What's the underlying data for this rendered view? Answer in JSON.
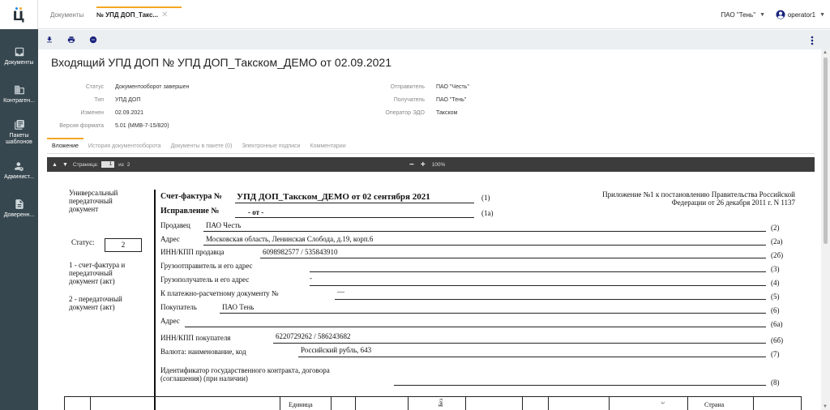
{
  "brand": {
    "letter": "Ц",
    "dot_colors": [
      "#1e88e5",
      "#f5a623"
    ]
  },
  "sidebar": {
    "items": [
      {
        "label": "Документы",
        "icon": "inbox-icon"
      },
      {
        "label": "Контраген...",
        "icon": "building-icon"
      },
      {
        "label": "Пакеты шаблонов",
        "icon": "layers-icon"
      },
      {
        "label": "Админист...",
        "icon": "admin-gear-icon"
      },
      {
        "label": "Доверенн...",
        "icon": "document-icon"
      }
    ]
  },
  "header": {
    "tabs": [
      {
        "label": "Документы",
        "active": false
      },
      {
        "label": "№ УПД ДОП_Такс...",
        "active": true
      }
    ],
    "close": "✕",
    "org": "ПАО \"Тень\"",
    "user": "operator1"
  },
  "toolbar": {
    "icons": [
      "download-icon",
      "print-icon",
      "minus-circle-icon"
    ],
    "more": "more-vert-icon"
  },
  "page": {
    "title": "Входящий УПД ДОП № УПД ДОП_Такском_ДЕМО от 02.09.2021",
    "meta_left": [
      {
        "k": "Статус",
        "v": "Документооборот завершен"
      },
      {
        "k": "Тип",
        "v": "УПД ДОП"
      },
      {
        "k": "Изменен",
        "v": "02.09.2021"
      },
      {
        "k": "Версия формата",
        "v": "5.01 (ММВ-7-15/820)"
      }
    ],
    "meta_right": [
      {
        "k": "Отправитель",
        "v": "ПАО \"Честь\""
      },
      {
        "k": "Получатель",
        "v": "ПАО \"Тень\""
      },
      {
        "k": "Оператор ЭДО",
        "v": "Такском"
      }
    ],
    "subtabs": [
      "Вложение",
      "История документооборота",
      "Документы в пакете (0)",
      "Электронные подписи",
      "Комментарии"
    ]
  },
  "viewer": {
    "page_label": "Страница:",
    "page": "1",
    "of": "из",
    "total": "2",
    "zoom": "100%",
    "minus": "−",
    "plus": "+"
  },
  "document": {
    "left_label": [
      "Универсальный",
      "передаточный",
      "документ"
    ],
    "status_label": "Статус:",
    "status_value": "2",
    "legend_1": [
      "1 - счет-фактура и",
      "передаточный",
      "документ (акт)"
    ],
    "legend_2": [
      "2 - передаточный",
      "документ (акт)"
    ],
    "invoice_label": "Счет-фактура №",
    "invoice_value": "УПД ДОП_Такском_ДЕМО от 02 сентября 2021",
    "correction_label": "Исправление №",
    "correction_value": "-      от      -",
    "appendix": [
      "Приложение №1 к постановлению Правительства Российской",
      "Федерации от 26 декабря 2011 г. N 1137"
    ],
    "rows": [
      {
        "k": "Продавец",
        "v": "ПАО Честь",
        "n": "(2)"
      },
      {
        "k": "Адрес",
        "v": "Московская область, Ленинская Слобода, д.19, корп.6",
        "n": "(2а)"
      },
      {
        "k": "ИНН/КПП продавца",
        "v": "6098982577 / 535843910",
        "n": "(2б)"
      },
      {
        "k": "Грузоотправитель и его адрес",
        "v": "",
        "n": "(3)"
      },
      {
        "k": "Грузополучатель и его адрес",
        "v": "-",
        "n": "(4)"
      },
      {
        "k": "К платежно-расчетному документу №",
        "v": "—",
        "n": "(5)"
      },
      {
        "k": "Покупатель",
        "v": "ПАО Тень",
        "n": "(6)"
      },
      {
        "k": "Адрес",
        "v": "",
        "n": "(6а)"
      },
      {
        "k": "ИНН/КПП покупателя",
        "v": "6220729262 / 586243682",
        "n": "(6б)"
      },
      {
        "k": "Валюта: наименование, код",
        "v": "Российский рубль, 643",
        "n": "(7)"
      }
    ],
    "gov_label": [
      "Идентификатор государственного контракта, договора",
      "(соглашения) (при наличии)"
    ],
    "gov_n": "(8)",
    "n1": "(1)",
    "n1a": "(1а)",
    "table_head": {
      "unit": "Единица",
      "country": "Страна",
      "bez": "Без",
      "c": "с"
    }
  }
}
